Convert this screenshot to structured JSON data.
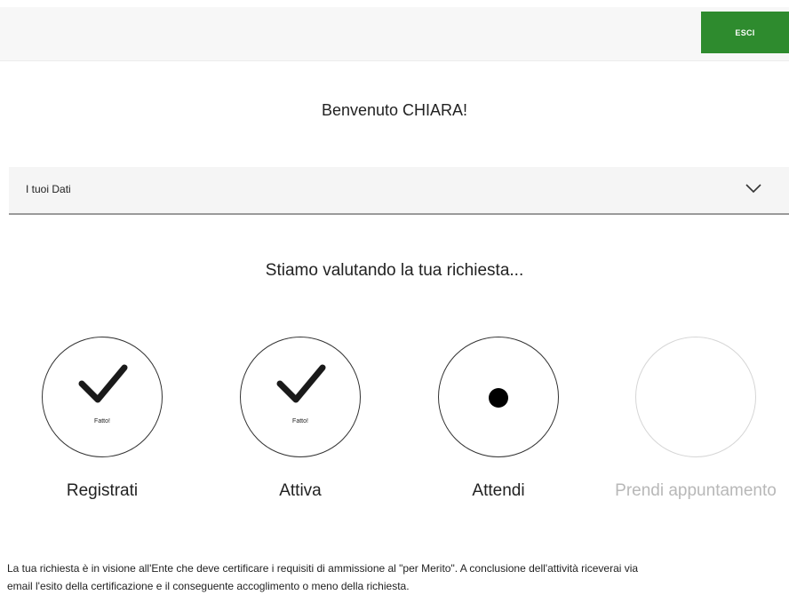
{
  "header": {
    "exit_label": "ESCI",
    "accent_color": "#2e8b2e"
  },
  "welcome": {
    "text": "Benvenuto CHIARA!"
  },
  "accordion": {
    "label": "I tuoi Dati",
    "icon": "chevron-down-icon",
    "expanded": false
  },
  "status": {
    "heading": "Stiamo valutando la tua richiesta..."
  },
  "steps": [
    {
      "label": "Registrati",
      "state": "done",
      "done_text": "Fatto!",
      "icon": "checkmark-icon"
    },
    {
      "label": "Attiva",
      "state": "done",
      "done_text": "Fatto!",
      "icon": "checkmark-icon"
    },
    {
      "label": "Attendi",
      "state": "current",
      "icon": "dot-icon"
    },
    {
      "label": "Prendi appuntamento",
      "state": "pending"
    }
  ],
  "info": {
    "line1": "La tua richiesta è in visione all'Ente che deve certificare i requisiti di ammissione al \"per Merito\". A conclusione dell'attività riceverai via",
    "line2": "email l'esito della certificazione e il conseguente accoglimento o meno della richiesta."
  }
}
